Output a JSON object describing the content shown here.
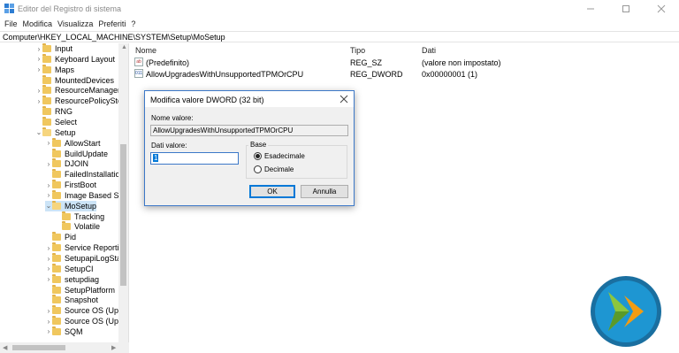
{
  "window": {
    "title": "Editor del Registro di sistema",
    "minimize_icon": "minimize-icon",
    "maximize_icon": "maximize-icon",
    "close_icon": "close-icon"
  },
  "menu": [
    "File",
    "Modifica",
    "Visualizza",
    "Preferiti",
    "?"
  ],
  "address": "Computer\\HKEY_LOCAL_MACHINE\\SYSTEM\\Setup\\MoSetup",
  "tree": [
    {
      "label": "Input",
      "expander": "›"
    },
    {
      "label": "Keyboard Layout",
      "expander": "›"
    },
    {
      "label": "Maps",
      "expander": "›"
    },
    {
      "label": "MountedDevices",
      "expander": ""
    },
    {
      "label": "ResourceManager",
      "expander": "›"
    },
    {
      "label": "ResourcePolicyStore",
      "expander": "›"
    },
    {
      "label": "RNG",
      "expander": ""
    },
    {
      "label": "Select",
      "expander": ""
    },
    {
      "label": "Setup",
      "expander": "⌄"
    },
    {
      "label": "AllowStart",
      "expander": "›"
    },
    {
      "label": "BuildUpdate",
      "expander": ""
    },
    {
      "label": "DJOIN",
      "expander": "›"
    },
    {
      "label": "FailedInstallations",
      "expander": ""
    },
    {
      "label": "FirstBoot",
      "expander": "›"
    },
    {
      "label": "Image Based Setu",
      "expander": "›"
    },
    {
      "label": "MoSetup",
      "expander": "⌄"
    },
    {
      "label": "Tracking",
      "expander": ""
    },
    {
      "label": "Volatile",
      "expander": ""
    },
    {
      "label": "Pid",
      "expander": ""
    },
    {
      "label": "Service Reporting",
      "expander": "›"
    },
    {
      "label": "SetupapiLogStatu",
      "expander": "›"
    },
    {
      "label": "SetupCI",
      "expander": "›"
    },
    {
      "label": "setupdiag",
      "expander": "›"
    },
    {
      "label": "SetupPlatform",
      "expander": ""
    },
    {
      "label": "Snapshot",
      "expander": ""
    },
    {
      "label": "Source OS (Updat",
      "expander": "›"
    },
    {
      "label": "Source OS (Updat",
      "expander": "›"
    },
    {
      "label": "SQM",
      "expander": "›"
    }
  ],
  "columns": {
    "name": "Nome",
    "type": "Tipo",
    "data": "Dati"
  },
  "values": [
    {
      "icon": "ab",
      "name": "(Predefinito)",
      "type": "REG_SZ",
      "data": "(valore non impostato)"
    },
    {
      "icon": "011",
      "name": "AllowUpgradesWithUnsupportedTPMOrCPU",
      "type": "REG_DWORD",
      "data": "0x00000001 (1)"
    }
  ],
  "dialog": {
    "title": "Modifica valore DWORD (32 bit)",
    "name_label": "Nome valore:",
    "name_value": "AllowUpgradesWithUnsupportedTPMOrCPU",
    "data_label": "Dati valore:",
    "data_value": "1",
    "base_label": "Base",
    "hex_label": "Esadecimale",
    "dec_label": "Decimale",
    "base_selected": "Esadecimale",
    "ok_label": "OK",
    "cancel_label": "Annulla"
  },
  "colors": {
    "accent": "#0078d7",
    "folder": "#f0c75e",
    "logo_ring": "#1a6fa0",
    "logo_fill": "#1e96d2",
    "logo_green": "#8cc63f",
    "logo_orange": "#f39c12"
  }
}
